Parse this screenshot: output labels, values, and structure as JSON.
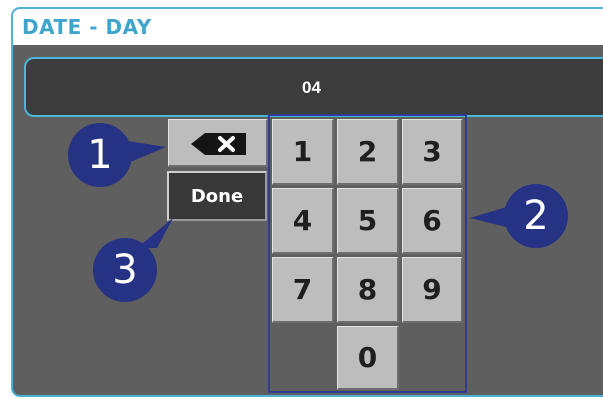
{
  "dialog": {
    "title": "DATE - DAY",
    "current_value": "04",
    "accent_color": "#4bb3d6"
  },
  "keypad": {
    "keys": [
      "1",
      "2",
      "3",
      "4",
      "5",
      "6",
      "7",
      "8",
      "9",
      "0"
    ],
    "backspace_icon": "backspace-x-icon",
    "done_label": "Done"
  },
  "callouts": {
    "one": "1",
    "two": "2",
    "three": "3",
    "color": "#263385"
  }
}
